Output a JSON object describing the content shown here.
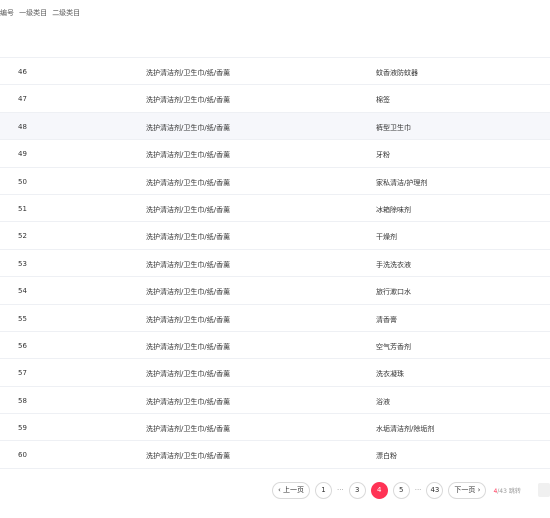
{
  "table": {
    "headers": {
      "id": "编号",
      "cat1": "一级类目",
      "cat2": "二级类目"
    },
    "rows": [
      {
        "id": "46",
        "cat1": "洗护清洁剂/卫生巾/纸/香薰",
        "cat2": "蚊香液防蚊器"
      },
      {
        "id": "47",
        "cat1": "洗护清洁剂/卫生巾/纸/香薰",
        "cat2": "棉签"
      },
      {
        "id": "48",
        "cat1": "洗护清洁剂/卫生巾/纸/香薰",
        "cat2": "裤型卫生巾"
      },
      {
        "id": "49",
        "cat1": "洗护清洁剂/卫生巾/纸/香薰",
        "cat2": "牙粉"
      },
      {
        "id": "50",
        "cat1": "洗护清洁剂/卫生巾/纸/香薰",
        "cat2": "家私清洁/护理剂"
      },
      {
        "id": "51",
        "cat1": "洗护清洁剂/卫生巾/纸/香薰",
        "cat2": "冰箱除味剂"
      },
      {
        "id": "52",
        "cat1": "洗护清洁剂/卫生巾/纸/香薰",
        "cat2": "干燥剂"
      },
      {
        "id": "53",
        "cat1": "洗护清洁剂/卫生巾/纸/香薰",
        "cat2": "手洗洗衣液"
      },
      {
        "id": "54",
        "cat1": "洗护清洁剂/卫生巾/纸/香薰",
        "cat2": "旅行漱口水"
      },
      {
        "id": "55",
        "cat1": "洗护清洁剂/卫生巾/纸/香薰",
        "cat2": "清香膏"
      },
      {
        "id": "56",
        "cat1": "洗护清洁剂/卫生巾/纸/香薰",
        "cat2": "空气芳香剂"
      },
      {
        "id": "57",
        "cat1": "洗护清洁剂/卫生巾/纸/香薰",
        "cat2": "洗衣凝珠"
      },
      {
        "id": "58",
        "cat1": "洗护清洁剂/卫生巾/纸/香薰",
        "cat2": "浴液"
      },
      {
        "id": "59",
        "cat1": "洗护清洁剂/卫生巾/纸/香薰",
        "cat2": "水垢清洁剂/除垢剂"
      },
      {
        "id": "60",
        "cat1": "洗护清洁剂/卫生巾/纸/香薰",
        "cat2": "漂白粉"
      }
    ]
  },
  "pagination": {
    "prev_label": "‹ 上一页",
    "next_label": "下一页 ›",
    "pages": [
      "1",
      "3",
      "4",
      "5",
      "43"
    ],
    "ellipsis": "···",
    "current": "4",
    "info_current": "4",
    "info_total": "/43",
    "goto_label": "跳转"
  },
  "colors": {
    "accent": "#ff3355",
    "row_alt": "#f6f7fb",
    "border": "#eef0f4"
  }
}
